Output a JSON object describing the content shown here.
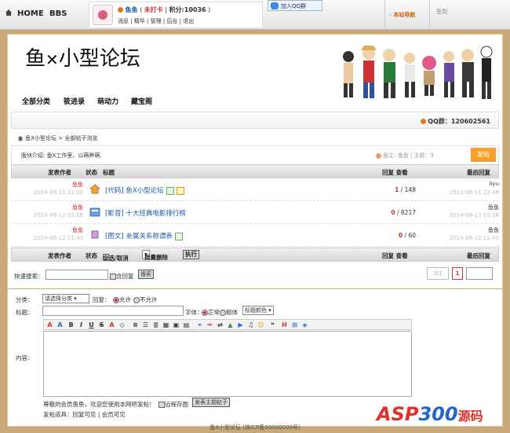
{
  "topbar": {
    "home": "HOME",
    "bbs": "BBS",
    "username": "鱼鱼",
    "checkin": "未打卡",
    "points_label": "积分:",
    "points": "10036",
    "links": [
      "消息",
      "精华",
      "管理",
      "后台",
      "退出"
    ],
    "qq_group_btn": "加入QQ群",
    "site_nav": "本站导航",
    "signin": "签到"
  },
  "header": {
    "logo_prefix": "鱼",
    "logo_x": "✕",
    "logo_suffix": "小型论坛",
    "menu": [
      "全部分类",
      "筱进录",
      "萌动力",
      "藏宝阁"
    ],
    "qq_text": "QQ群：120602561"
  },
  "breadcrumb": {
    "forum": "鱼X小型论坛",
    "sep": ">",
    "page": "全部帖子浏览"
  },
  "board": {
    "intro": "版块介绍: 鱼X工作室，以萌养萌.",
    "moderator": "版主: 鱼鱼 | 主题：3",
    "post_button": "发帖"
  },
  "table": {
    "headers": {
      "author": "发表作者",
      "status": "状态",
      "title": "标题",
      "reply_view": "回复 查看",
      "last": "最后回复"
    },
    "rows": [
      {
        "author": "鱼鱼",
        "date": "2014-06-11 11:03",
        "title": "[代码] 鱼X小型论坛",
        "replies": "1",
        "views": "148",
        "last_user": "liyu",
        "last_date": "2014-06-11 12:49",
        "tags": [
          "new",
          "hot"
        ]
      },
      {
        "author": "鱼鱼",
        "date": "2014-06-13 10:18",
        "title": "[影音] 十大经典电影排行榜",
        "replies": "0",
        "views": "8217",
        "last_user": "鱼鱼",
        "last_date": "2014-06-13 10:18",
        "tags": []
      },
      {
        "author": "鱼鱼",
        "date": "2014-06-12 11:43",
        "title": "[图文] 亲属关系称谓表",
        "replies": "0",
        "views": "60",
        "last_user": "鱼鱼",
        "last_date": "2014-06-12 11:43",
        "tags": [
          "new"
        ]
      }
    ],
    "footer": {
      "select_all": "全选/取消",
      "batch_delete": "批量删除",
      "execute": "执行"
    }
  },
  "search": {
    "label": "快速搜索：",
    "include_replies": "含回复",
    "button": "搜索",
    "page_info": "3/1",
    "current_page": "1"
  },
  "compose": {
    "category_label": "分类：",
    "category_select": "请选择分类",
    "reply_label": "回复：",
    "allow": "允许",
    "disallow": "不允许",
    "title_label": "标题：",
    "font_label": "字体：",
    "normal": "正常",
    "bold": "粗体",
    "title_color": "标题颜色",
    "content_label": "内容：",
    "notice": "尊敬的会员鱼鱼，欢迎您使用本网吧发帖！",
    "remote_save": "远程存图",
    "submit": "发表主题帖子",
    "tools_label": "发帖道具：",
    "tools": "回复可见 | 会员可见"
  },
  "footer": {
    "text": "鱼X小型论坛 (陕ICP备00000000号)"
  },
  "watermark": {
    "part1": "ASP",
    "part2": "300",
    "part3": "源码"
  },
  "colors": {
    "accent": "#f6a02b",
    "link": "#1a5aa8",
    "red": "#cc3333",
    "frame": "#c8a878"
  }
}
